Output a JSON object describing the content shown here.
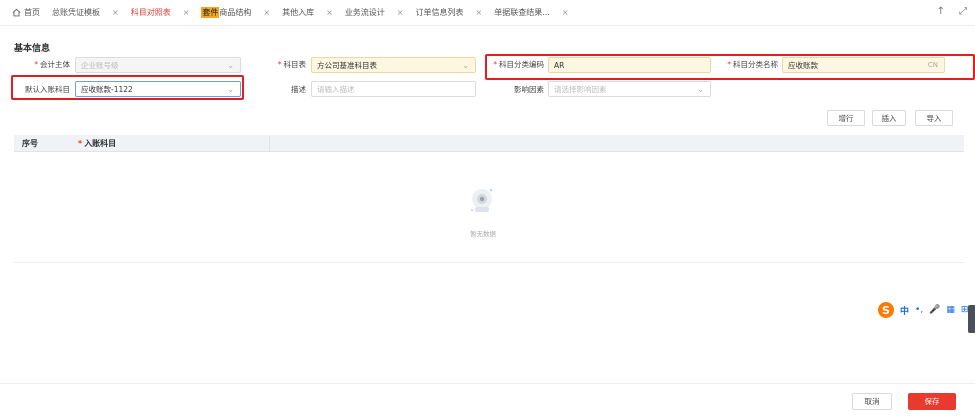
{
  "tabs": [
    {
      "label": "首页",
      "closable": false,
      "active": false,
      "icon": "home-icon"
    },
    {
      "label": "总账凭证模板",
      "closable": true,
      "active": false
    },
    {
      "label": "科目对照表",
      "closable": true,
      "active": true
    },
    {
      "label_highlight": "套件",
      "label": "商品结构",
      "closable": true,
      "active": false
    },
    {
      "label": "其他入库",
      "closable": true,
      "active": false
    },
    {
      "label": "业务流设计",
      "closable": true,
      "active": false
    },
    {
      "label": "订单信息列表",
      "closable": true,
      "active": false
    },
    {
      "label": "单据联查结果...",
      "closable": true,
      "active": false
    }
  ],
  "tab_close_glyph": "×",
  "tab_tools": {
    "up": "↑",
    "expand": "⤢"
  },
  "section_title": "基本信息",
  "form": {
    "accounting_entity": {
      "label": "会计主体",
      "required": true,
      "placeholder": "企业账号级"
    },
    "account_table": {
      "label": "科目表",
      "required": true,
      "value": "方公司基准科目表"
    },
    "category_code": {
      "label": "科目分类编码",
      "required": true,
      "value": "AR"
    },
    "category_name": {
      "label": "科目分类名称",
      "required": true,
      "value": "应收账款",
      "suffix": "CN"
    },
    "default_account": {
      "label": "默认入账科目",
      "required": false,
      "value": "应收账款-1122"
    },
    "description": {
      "label": "描述",
      "placeholder": "请输入描述"
    },
    "impact_factor": {
      "label": "影响因素",
      "placeholder": "请选择影响因素"
    }
  },
  "required_mark": "*",
  "toolbar": {
    "add_row": "增行",
    "insert": "插入",
    "import": "导入"
  },
  "table": {
    "columns": [
      {
        "label": "序号",
        "required": false
      },
      {
        "label": "入账科目",
        "required": true
      }
    ],
    "empty_text": "暂无数据"
  },
  "footer": {
    "cancel": "取消",
    "save": "保存"
  },
  "ime": {
    "logo": "S",
    "lang": "中",
    "punct": "•,",
    "mic": "🎤",
    "keyboard": "▦",
    "grid": "⊞"
  },
  "colors": {
    "accent": "#e83a2f",
    "highlight_box": "#e02020",
    "header_bg": "#f0f2f5"
  }
}
